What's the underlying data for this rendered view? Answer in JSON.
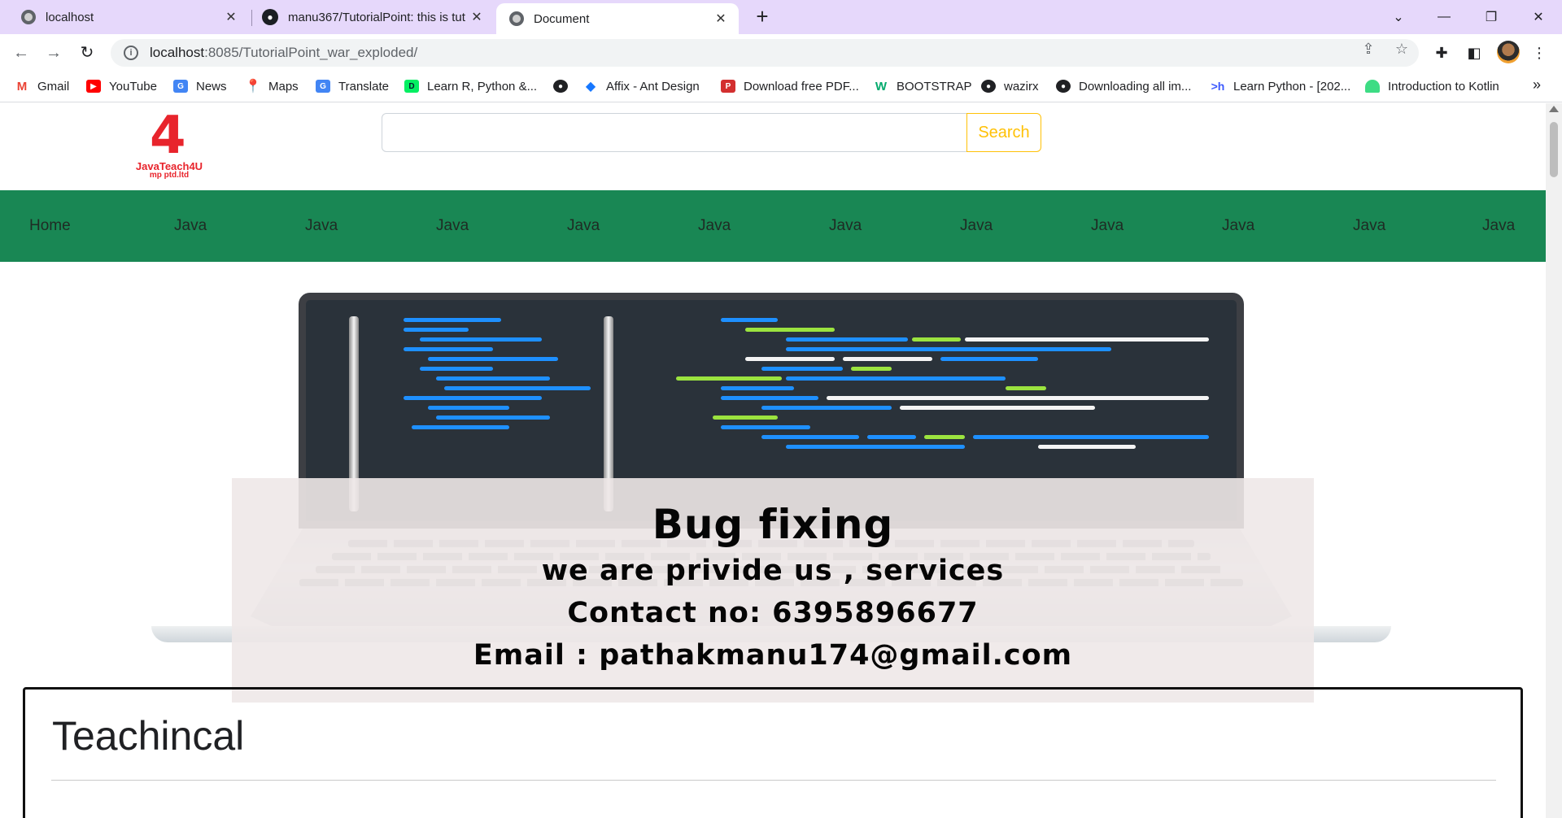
{
  "browser": {
    "tabs": [
      {
        "title": "localhost",
        "icon": "globe-icon",
        "active": false
      },
      {
        "title": "manu367/TutorialPoint: this is tut",
        "icon": "github-icon",
        "active": false
      },
      {
        "title": "Document",
        "icon": "globe-icon",
        "active": true
      }
    ],
    "new_tab_label": "+",
    "address": {
      "host": "localhost",
      "path": ":8085/TutorialPoint_war_exploded/"
    },
    "bookmarks": [
      {
        "label": "Gmail",
        "icon": "gmail-icon",
        "color": "#ea4335"
      },
      {
        "label": "YouTube",
        "icon": "youtube-icon",
        "color": "#ff0000"
      },
      {
        "label": "News",
        "icon": "news-icon",
        "color": "#4285f4"
      },
      {
        "label": "Maps",
        "icon": "maps-icon",
        "color": "#34a853"
      },
      {
        "label": "Translate",
        "icon": "translate-icon",
        "color": "#4285f4"
      },
      {
        "label": "Learn R, Python &...",
        "icon": "datacamp-icon",
        "color": "#03ef62"
      },
      {
        "label": "",
        "icon": "globe-icon",
        "color": "#202124"
      },
      {
        "label": "Affix - Ant Design",
        "icon": "antdesign-icon",
        "color": "#1677ff"
      },
      {
        "label": "Download free PDF...",
        "icon": "pdf-icon",
        "color": "#d32f2f"
      },
      {
        "label": "BOOTSTRAP",
        "icon": "w3schools-icon",
        "color": "#04aa6d"
      },
      {
        "label": "wazirx",
        "icon": "globe-icon",
        "color": "#202124"
      },
      {
        "label": "Downloading all im...",
        "icon": "globe-icon",
        "color": "#202124"
      },
      {
        "label": "Learn Python - [202...",
        "icon": "hackr-icon",
        "color": "#3d5afe"
      },
      {
        "label": "Introduction to Kotlin",
        "icon": "android-icon",
        "color": "#3ddc84"
      }
    ]
  },
  "site": {
    "logo": {
      "text": "JavaTeach4U",
      "sub": "mp ptd.ltd"
    },
    "search": {
      "placeholder": "",
      "button_label": "Search"
    },
    "nav": [
      "Home",
      "Java",
      "Java",
      "Java",
      "Java",
      "Java",
      "Java",
      "Java",
      "Java",
      "Java",
      "Java",
      "Java"
    ],
    "hero": {
      "title": "Bug fixing",
      "line1": "we are privide us , services",
      "line2": "Contact no: 6395896677",
      "line3": "Email : pathakmanu174@gmail.com"
    },
    "card": {
      "title": "Teachincal"
    }
  },
  "colors": {
    "navbar": "#198754",
    "search_button": "#ffc107",
    "logo": "#e8242c",
    "tabstrip": "#e6d8fb"
  }
}
